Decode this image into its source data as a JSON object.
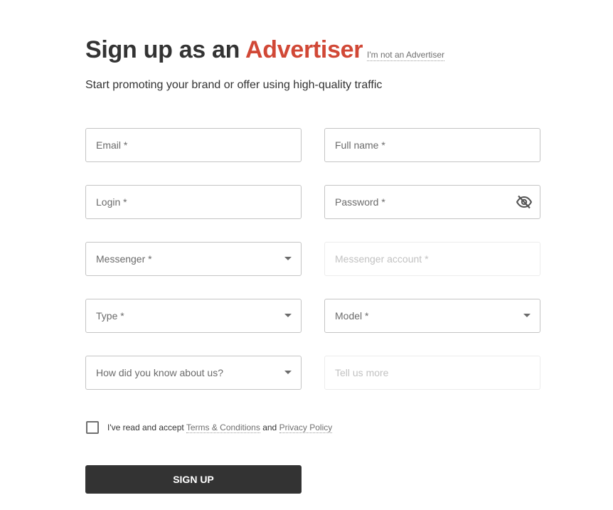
{
  "header": {
    "title_prefix": "Sign up as an ",
    "title_accent": "Advertiser",
    "switch_role_link": "I'm not an Advertiser",
    "subtitle": "Start promoting your brand or offer using high-quality traffic"
  },
  "colors": {
    "accent": "#d14836",
    "text": "#333333",
    "button_bg": "#333333",
    "button_text": "#ffffff",
    "border": "#c4c4c4"
  },
  "form": {
    "email": {
      "placeholder": "Email *",
      "value": ""
    },
    "full_name": {
      "placeholder": "Full name *",
      "value": ""
    },
    "login": {
      "placeholder": "Login *",
      "value": ""
    },
    "password": {
      "placeholder": "Password *",
      "value": "",
      "toggle_icon": "eye-slash-icon"
    },
    "messenger": {
      "placeholder": "Messenger *",
      "selected": ""
    },
    "messenger_account": {
      "placeholder": "Messenger account *",
      "value": "",
      "disabled": true
    },
    "type": {
      "placeholder": "Type *",
      "selected": ""
    },
    "model": {
      "placeholder": "Model *",
      "selected": ""
    },
    "source": {
      "placeholder": "How did you know about us?",
      "selected": ""
    },
    "tell_more": {
      "placeholder": "Tell us more",
      "value": "",
      "disabled": true
    }
  },
  "consent": {
    "checked": false,
    "text_before": "I've read and accept ",
    "terms_link": "Terms & Conditions",
    "text_middle": " and ",
    "privacy_link": "Privacy Policy"
  },
  "submit": {
    "label": "SIGN UP"
  }
}
